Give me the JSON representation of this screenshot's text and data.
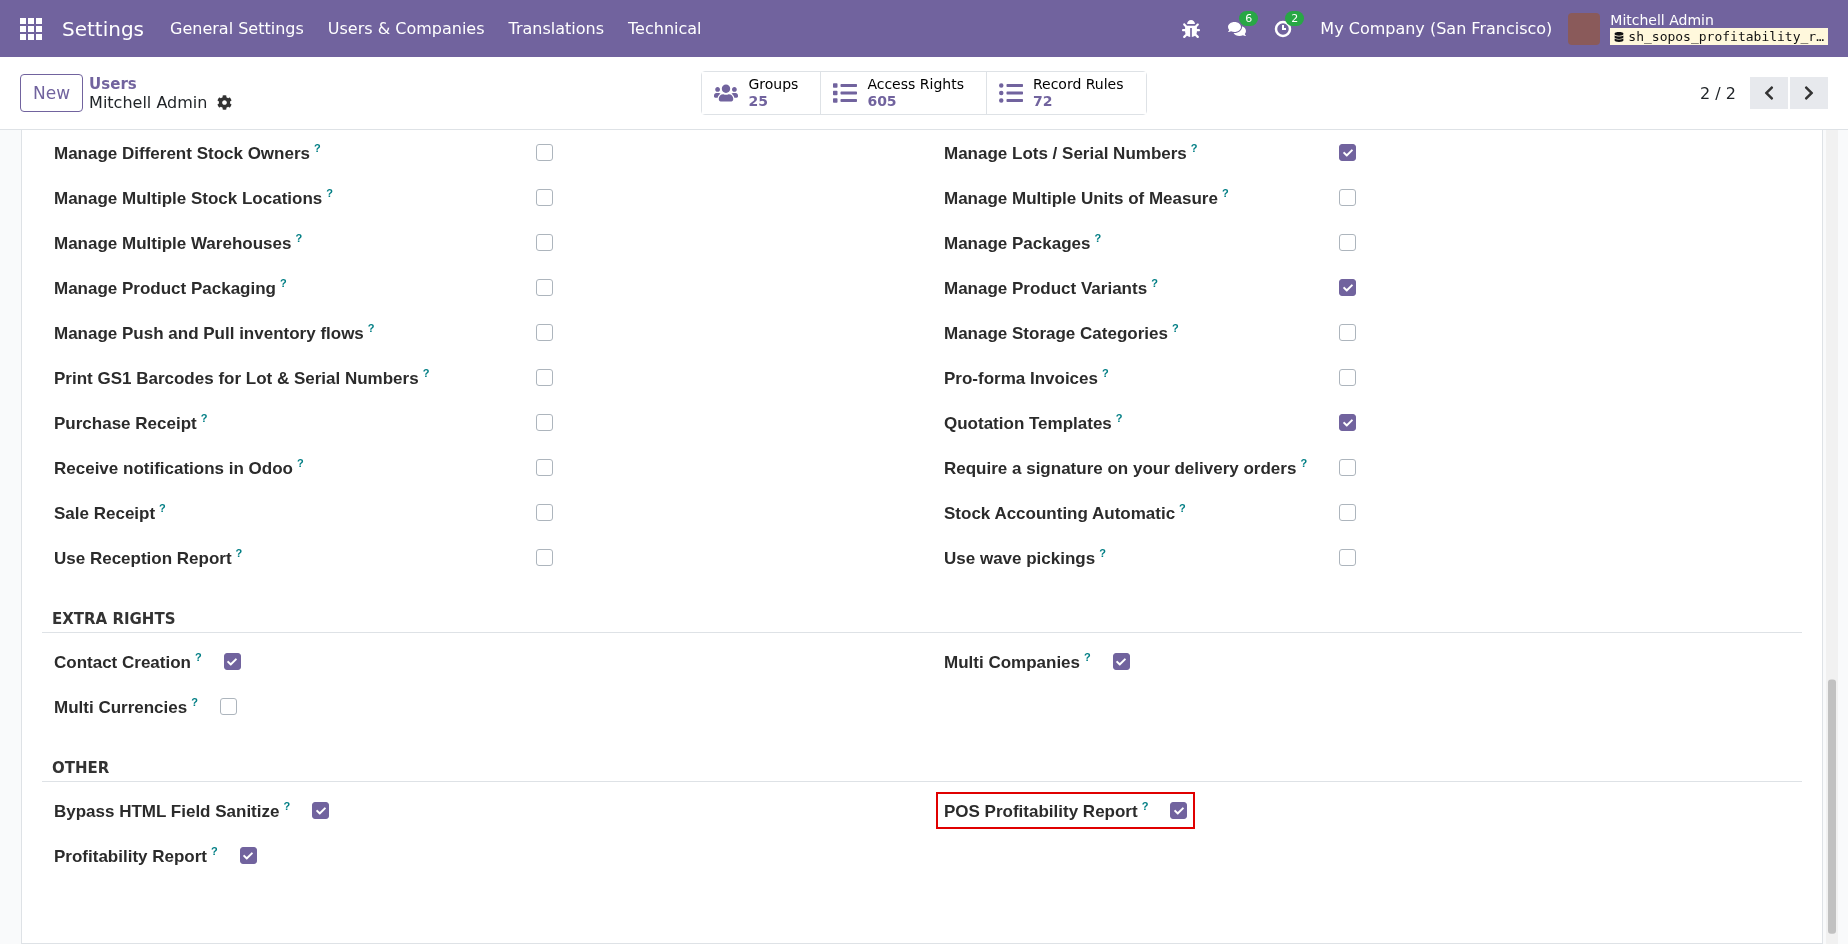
{
  "navbar": {
    "app": "Settings",
    "menus": [
      "General Settings",
      "Users & Companies",
      "Translations",
      "Technical"
    ],
    "chat_count": "6",
    "activity_count": "2",
    "company": "My Company (San Francisco)",
    "user": "Mitchell Admin",
    "database": "sh_sopos_profitability_r…"
  },
  "control_panel": {
    "new_button": "New",
    "breadcrumb": "Users",
    "record": "Mitchell Admin",
    "smart_buttons": [
      {
        "kind": "groups",
        "label": "Groups",
        "count": "25"
      },
      {
        "kind": "list",
        "label": "Access Rights",
        "count": "605"
      },
      {
        "kind": "rules",
        "label": "Record Rules",
        "count": "72"
      }
    ],
    "pager": "2 / 2"
  },
  "sections": [
    {
      "kind": "table",
      "items": [
        {
          "label": "Manage Different Stock Owners",
          "help": "?",
          "checked": false,
          "highlighted": false
        },
        {
          "label": "Manage Lots / Serial Numbers",
          "help": "?",
          "checked": true,
          "highlighted": false
        },
        {
          "label": "Manage Multiple Stock Locations",
          "help": "?",
          "checked": false,
          "highlighted": false
        },
        {
          "label": "Manage Multiple Units of Measure",
          "help": "?",
          "checked": false,
          "highlighted": false
        },
        {
          "label": "Manage Multiple Warehouses",
          "help": "?",
          "checked": false,
          "highlighted": false
        },
        {
          "label": "Manage Packages",
          "help": "?",
          "checked": false,
          "highlighted": false
        },
        {
          "label": "Manage Product Packaging",
          "help": "?",
          "checked": false,
          "highlighted": false
        },
        {
          "label": "Manage Product Variants",
          "help": "?",
          "checked": true,
          "highlighted": false
        },
        {
          "label": "Manage Push and Pull inventory flows",
          "help": "?",
          "checked": false,
          "highlighted": false
        },
        {
          "label": "Manage Storage Categories",
          "help": "?",
          "checked": false,
          "highlighted": false
        },
        {
          "label": "Print GS1 Barcodes for Lot & Serial Numbers",
          "help": "?",
          "checked": false,
          "highlighted": false
        },
        {
          "label": "Pro-forma Invoices",
          "help": "?",
          "checked": false,
          "highlighted": false
        },
        {
          "label": "Purchase Receipt",
          "help": "?",
          "checked": false,
          "highlighted": false
        },
        {
          "label": "Quotation Templates",
          "help": "?",
          "checked": true,
          "highlighted": false
        },
        {
          "label": "Receive notifications in Odoo",
          "help": "?",
          "checked": false,
          "highlighted": false
        },
        {
          "label": "Require a signature on your delivery orders",
          "help": "?",
          "checked": false,
          "highlighted": false
        },
        {
          "label": "Sale Receipt",
          "help": "?",
          "checked": false,
          "highlighted": false
        },
        {
          "label": "Stock Accounting Automatic",
          "help": "?",
          "checked": false,
          "highlighted": false
        },
        {
          "label": "Use Reception Report",
          "help": "?",
          "checked": false,
          "highlighted": false
        },
        {
          "label": "Use wave pickings",
          "help": "?",
          "checked": false,
          "highlighted": false
        }
      ]
    },
    {
      "kind": "inline",
      "title": "EXTRA RIGHTS",
      "items": [
        {
          "label": "Contact Creation",
          "help": "?",
          "checked": true,
          "highlighted": false
        },
        {
          "label": "Multi Companies",
          "help": "?",
          "checked": true,
          "highlighted": false
        },
        {
          "label": "Multi Currencies",
          "help": "?",
          "checked": false,
          "highlighted": false
        }
      ]
    },
    {
      "kind": "inline",
      "title": "OTHER",
      "items": [
        {
          "label": "Bypass HTML Field Sanitize",
          "help": "?",
          "checked": true,
          "highlighted": false
        },
        {
          "label": "POS Profitability Report",
          "help": "?",
          "checked": true,
          "highlighted": true
        },
        {
          "label": "Profitability Report",
          "help": "?",
          "checked": true,
          "highlighted": false
        }
      ]
    }
  ]
}
